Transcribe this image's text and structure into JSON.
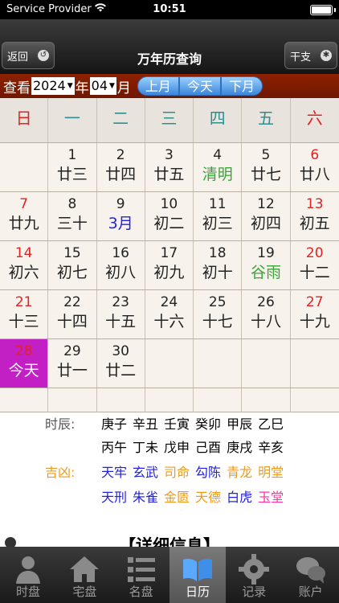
{
  "status": {
    "carrier": "Service Provider",
    "time": "10:51"
  },
  "nav": {
    "title": "万年历查询",
    "back": "返回",
    "ganzhi": "干支"
  },
  "query": {
    "prefix": "查看",
    "year": "2024",
    "year_unit": "年",
    "month": "04",
    "month_unit": "月",
    "prev": "上月",
    "today": "今天",
    "next": "下月"
  },
  "weekdays": [
    "日",
    "一",
    "二",
    "三",
    "四",
    "五",
    "六"
  ],
  "weeks": [
    [
      {
        "d": "",
        "l": ""
      },
      {
        "d": "1",
        "l": "廿三"
      },
      {
        "d": "2",
        "l": "廿四"
      },
      {
        "d": "3",
        "l": "廿五"
      },
      {
        "d": "4",
        "l": "清明"
      },
      {
        "d": "5",
        "l": "廿七"
      },
      {
        "d": "6",
        "l": "廿八"
      }
    ],
    [
      {
        "d": "7",
        "l": "廿九"
      },
      {
        "d": "8",
        "l": "三十"
      },
      {
        "d": "9",
        "l": "3月"
      },
      {
        "d": "10",
        "l": "初二"
      },
      {
        "d": "11",
        "l": "初三"
      },
      {
        "d": "12",
        "l": "初四"
      },
      {
        "d": "13",
        "l": "初五"
      }
    ],
    [
      {
        "d": "14",
        "l": "初六"
      },
      {
        "d": "15",
        "l": "初七"
      },
      {
        "d": "16",
        "l": "初八"
      },
      {
        "d": "17",
        "l": "初九"
      },
      {
        "d": "18",
        "l": "初十"
      },
      {
        "d": "19",
        "l": "谷雨"
      },
      {
        "d": "20",
        "l": "十二"
      }
    ],
    [
      {
        "d": "21",
        "l": "十三"
      },
      {
        "d": "22",
        "l": "十四"
      },
      {
        "d": "23",
        "l": "十五"
      },
      {
        "d": "24",
        "l": "十六"
      },
      {
        "d": "25",
        "l": "十七"
      },
      {
        "d": "26",
        "l": "十八"
      },
      {
        "d": "27",
        "l": "十九"
      }
    ],
    [
      {
        "d": "28",
        "l": "今天"
      },
      {
        "d": "29",
        "l": "廿一"
      },
      {
        "d": "30",
        "l": "廿二"
      },
      {
        "d": "",
        "l": ""
      },
      {
        "d": "",
        "l": ""
      },
      {
        "d": "",
        "l": ""
      },
      {
        "d": "",
        "l": ""
      }
    ]
  ],
  "shichen": {
    "label": "时辰:",
    "row1": [
      "庚子",
      "辛丑",
      "壬寅",
      "癸卯",
      "甲辰",
      "乙巳"
    ],
    "row2": [
      "丙午",
      "丁未",
      "戊申",
      "己酉",
      "庚戌",
      "辛亥"
    ]
  },
  "jixiong": {
    "label": "吉凶:",
    "row1": [
      {
        "t": "天牢",
        "c": "blue"
      },
      {
        "t": "玄武",
        "c": "blue"
      },
      {
        "t": "司命",
        "c": "orange"
      },
      {
        "t": "勾陈",
        "c": "blue"
      },
      {
        "t": "青龙",
        "c": "orange"
      },
      {
        "t": "明堂",
        "c": "orange"
      }
    ],
    "row2": [
      {
        "t": "天刑",
        "c": "blue"
      },
      {
        "t": "朱雀",
        "c": "blue"
      },
      {
        "t": "金匮",
        "c": "orange"
      },
      {
        "t": "天德",
        "c": "orange"
      },
      {
        "t": "白虎",
        "c": "blue"
      },
      {
        "t": "玉堂",
        "c": "pink"
      }
    ]
  },
  "detail": {
    "title": "【详细信息】"
  },
  "tabs": [
    "时盘",
    "宅盘",
    "名盘",
    "日历",
    "记录",
    "账户"
  ],
  "colors": {
    "accent": "#c21fc5",
    "query_bar": "#7c1c00",
    "sunday": "#e32222",
    "weekday": "#2f8f8f"
  }
}
